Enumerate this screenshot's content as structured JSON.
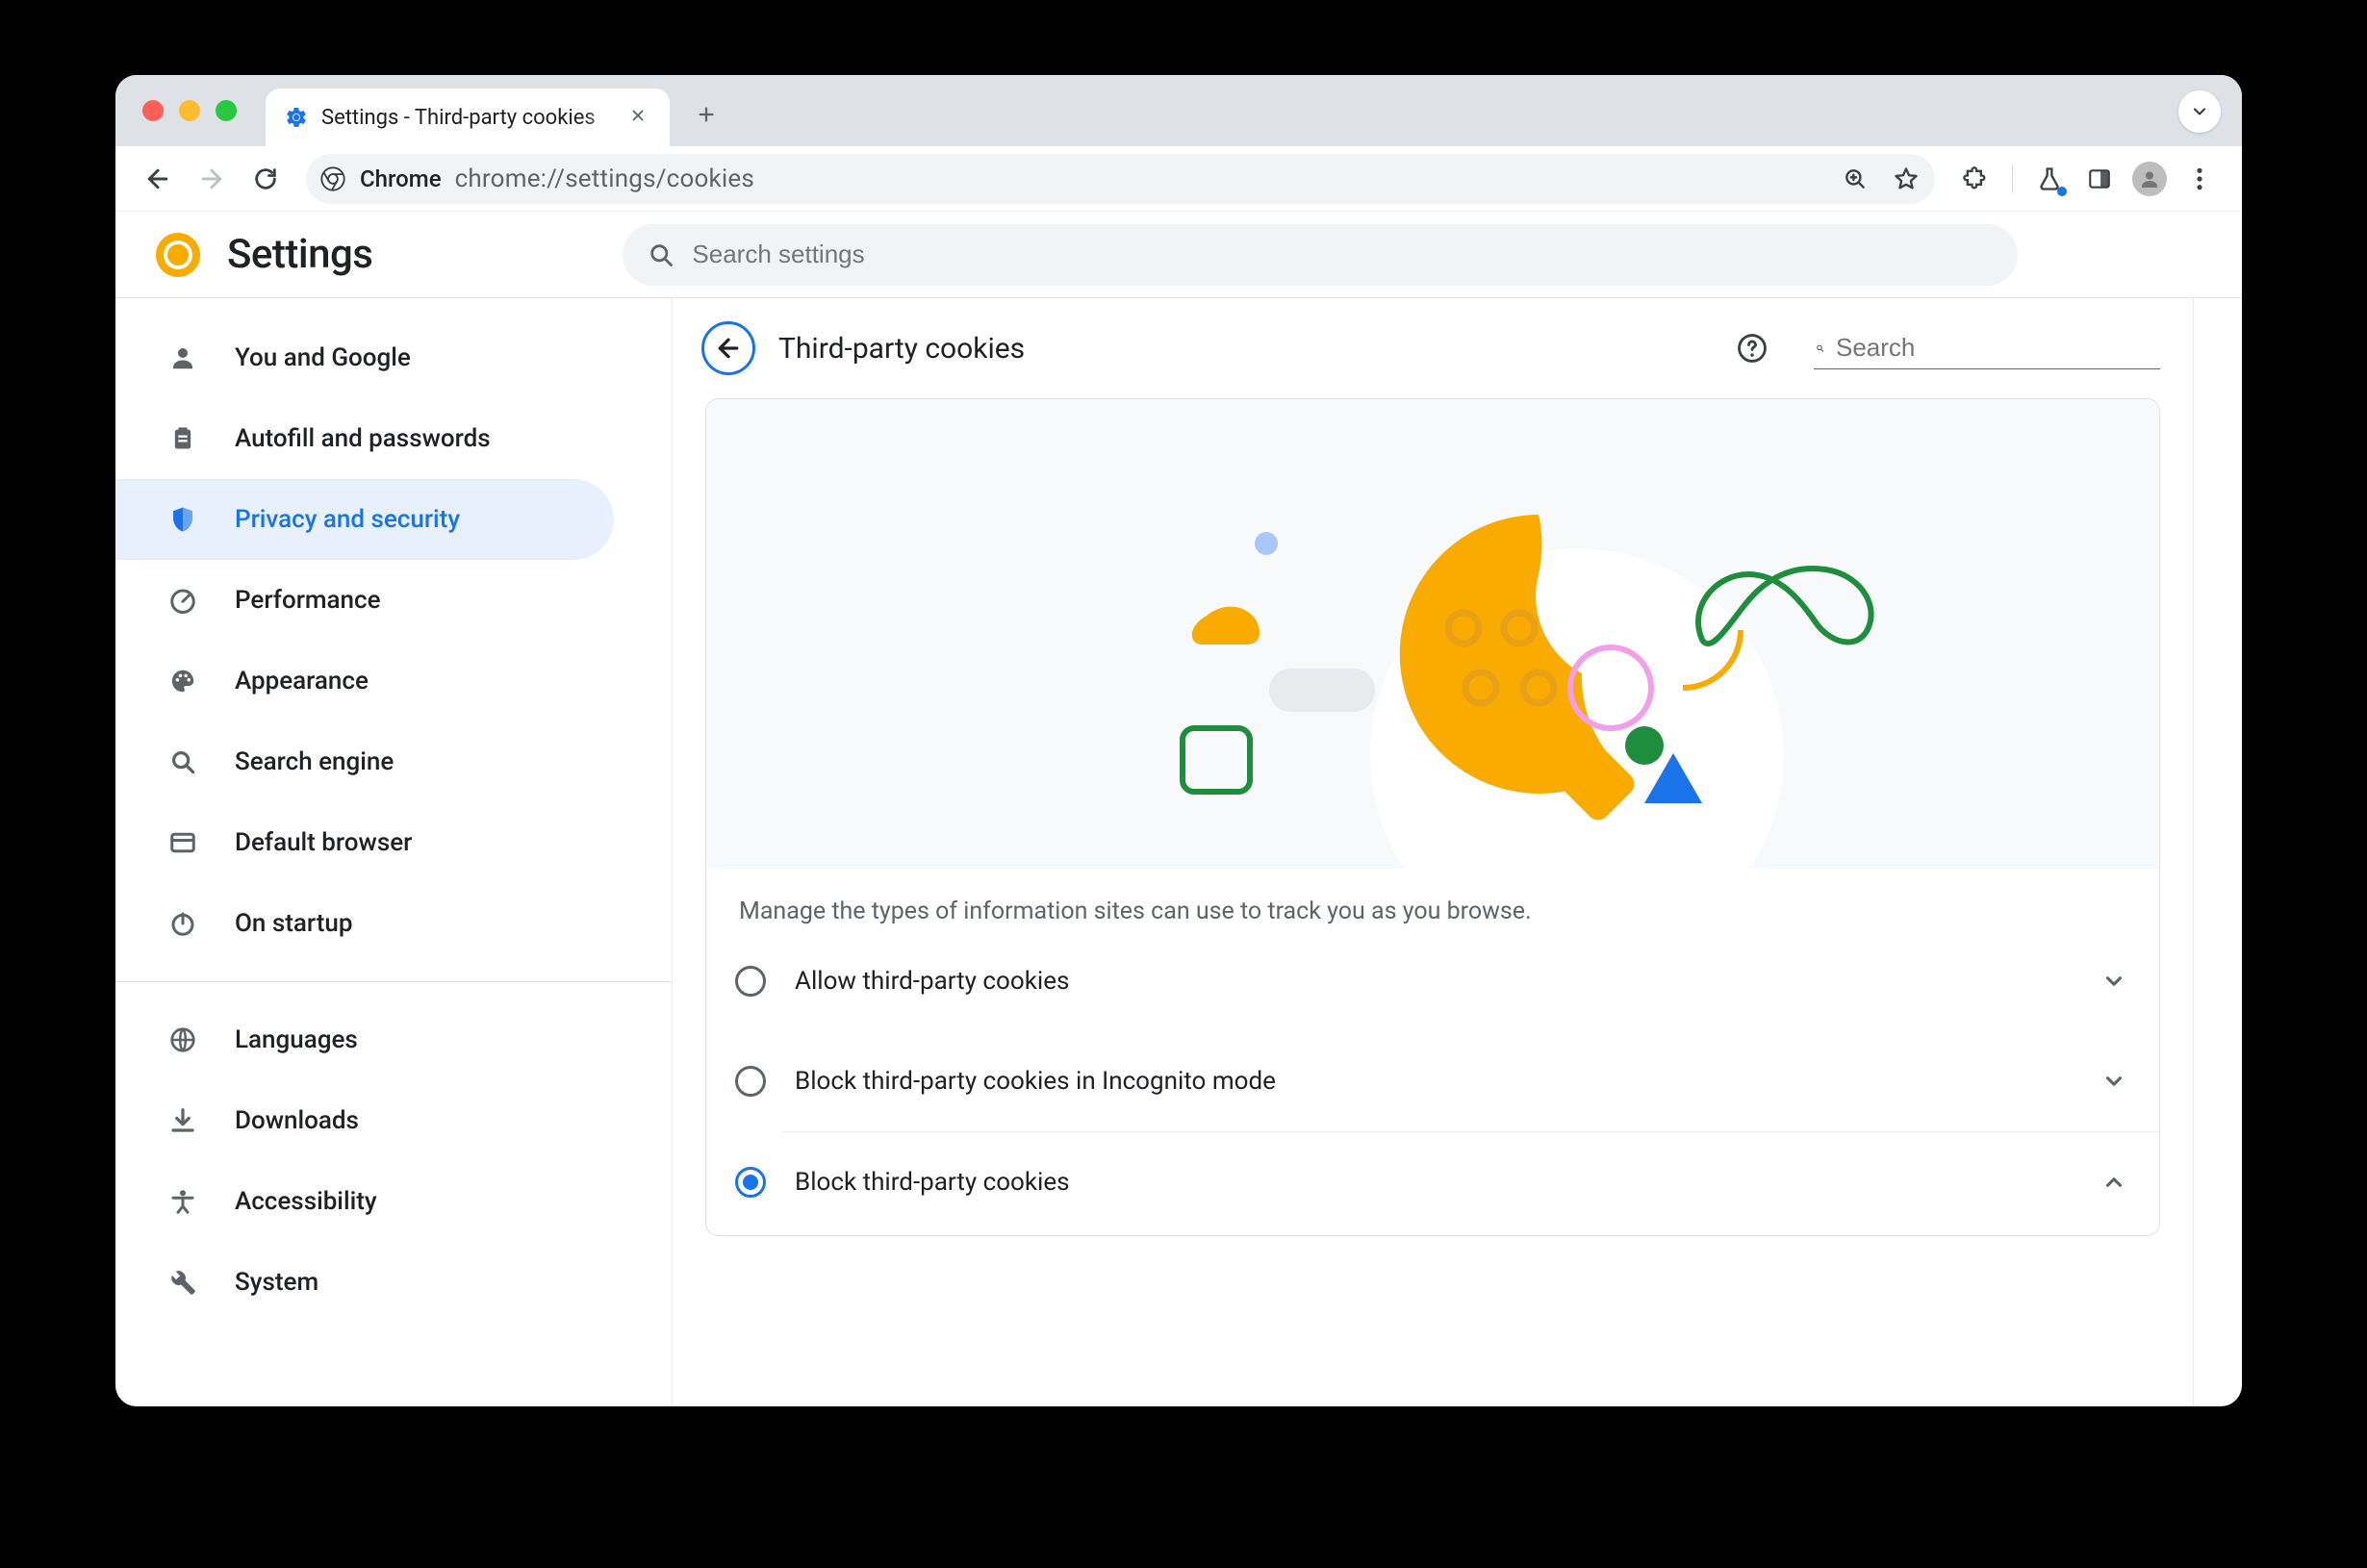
{
  "browser": {
    "tab_title": "Settings - Third-party cookies",
    "url_chip": "Chrome",
    "url": "chrome://settings/cookies"
  },
  "settings": {
    "title": "Settings",
    "search_placeholder": "Search settings"
  },
  "sidebar": {
    "items": [
      {
        "label": "You and Google"
      },
      {
        "label": "Autofill and passwords"
      },
      {
        "label": "Privacy and security"
      },
      {
        "label": "Performance"
      },
      {
        "label": "Appearance"
      },
      {
        "label": "Search engine"
      },
      {
        "label": "Default browser"
      },
      {
        "label": "On startup"
      }
    ],
    "items2": [
      {
        "label": "Languages"
      },
      {
        "label": "Downloads"
      },
      {
        "label": "Accessibility"
      },
      {
        "label": "System"
      }
    ]
  },
  "page": {
    "title": "Third-party cookies",
    "search_placeholder": "Search",
    "description": "Manage the types of information sites can use to track you as you browse.",
    "options": [
      {
        "label": "Allow third-party cookies",
        "selected": false,
        "expanded": false
      },
      {
        "label": "Block third-party cookies in Incognito mode",
        "selected": false,
        "expanded": false
      },
      {
        "label": "Block third-party cookies",
        "selected": true,
        "expanded": true
      }
    ]
  }
}
